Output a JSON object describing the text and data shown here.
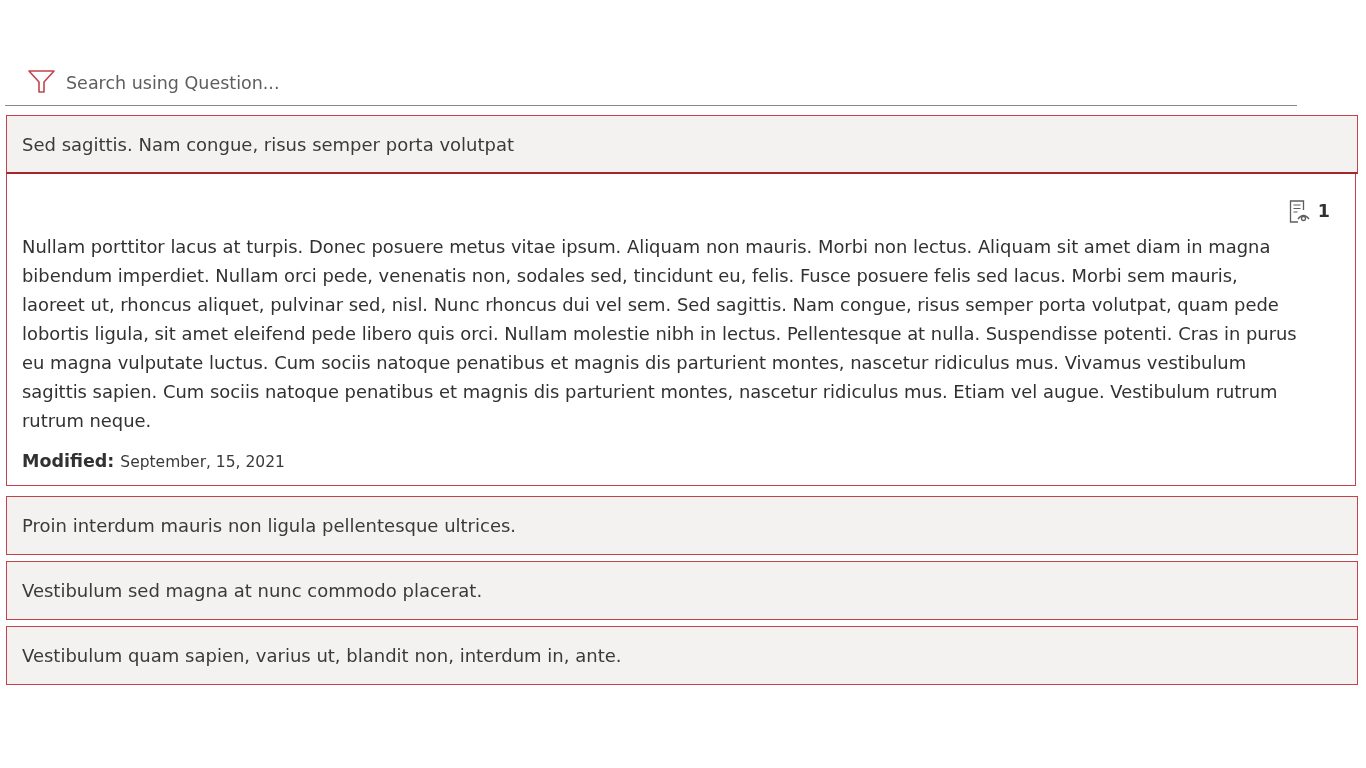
{
  "search": {
    "placeholder": "Search using Question..."
  },
  "faq": [
    {
      "question": "Sed sagittis. Nam congue, risus semper porta volutpat",
      "expanded": true,
      "view_count": "1",
      "answer": "Nullam porttitor lacus at turpis. Donec posuere metus vitae ipsum. Aliquam non mauris. Morbi non lectus. Aliquam sit amet diam in magna bibendum imperdiet. Nullam orci pede, venenatis non, sodales sed, tincidunt eu, felis. Fusce posuere felis sed lacus. Morbi sem mauris, laoreet ut, rhoncus aliquet, pulvinar sed, nisl. Nunc rhoncus dui vel sem. Sed sagittis. Nam congue, risus semper porta volutpat, quam pede lobortis ligula, sit amet eleifend pede libero quis orci. Nullam molestie nibh in lectus. Pellentesque at nulla. Suspendisse potenti. Cras in purus eu magna vulputate luctus. Cum sociis natoque penatibus et magnis dis parturient montes, nascetur ridiculus mus. Vivamus vestibulum sagittis sapien. Cum sociis natoque penatibus et magnis dis parturient montes, nascetur ridiculus mus. Etiam vel augue. Vestibulum rutrum rutrum neque.",
      "modified_label": "Modified:",
      "modified": "September, 15, 2021"
    },
    {
      "question": "Proin interdum mauris non ligula pellentesque ultrices.",
      "expanded": false
    },
    {
      "question": "Vestibulum sed magna at nunc commodo placerat.",
      "expanded": false
    },
    {
      "question": "Vestibulum quam sapien, varius ut, blandit non, interdum in, ante.",
      "expanded": false
    }
  ]
}
